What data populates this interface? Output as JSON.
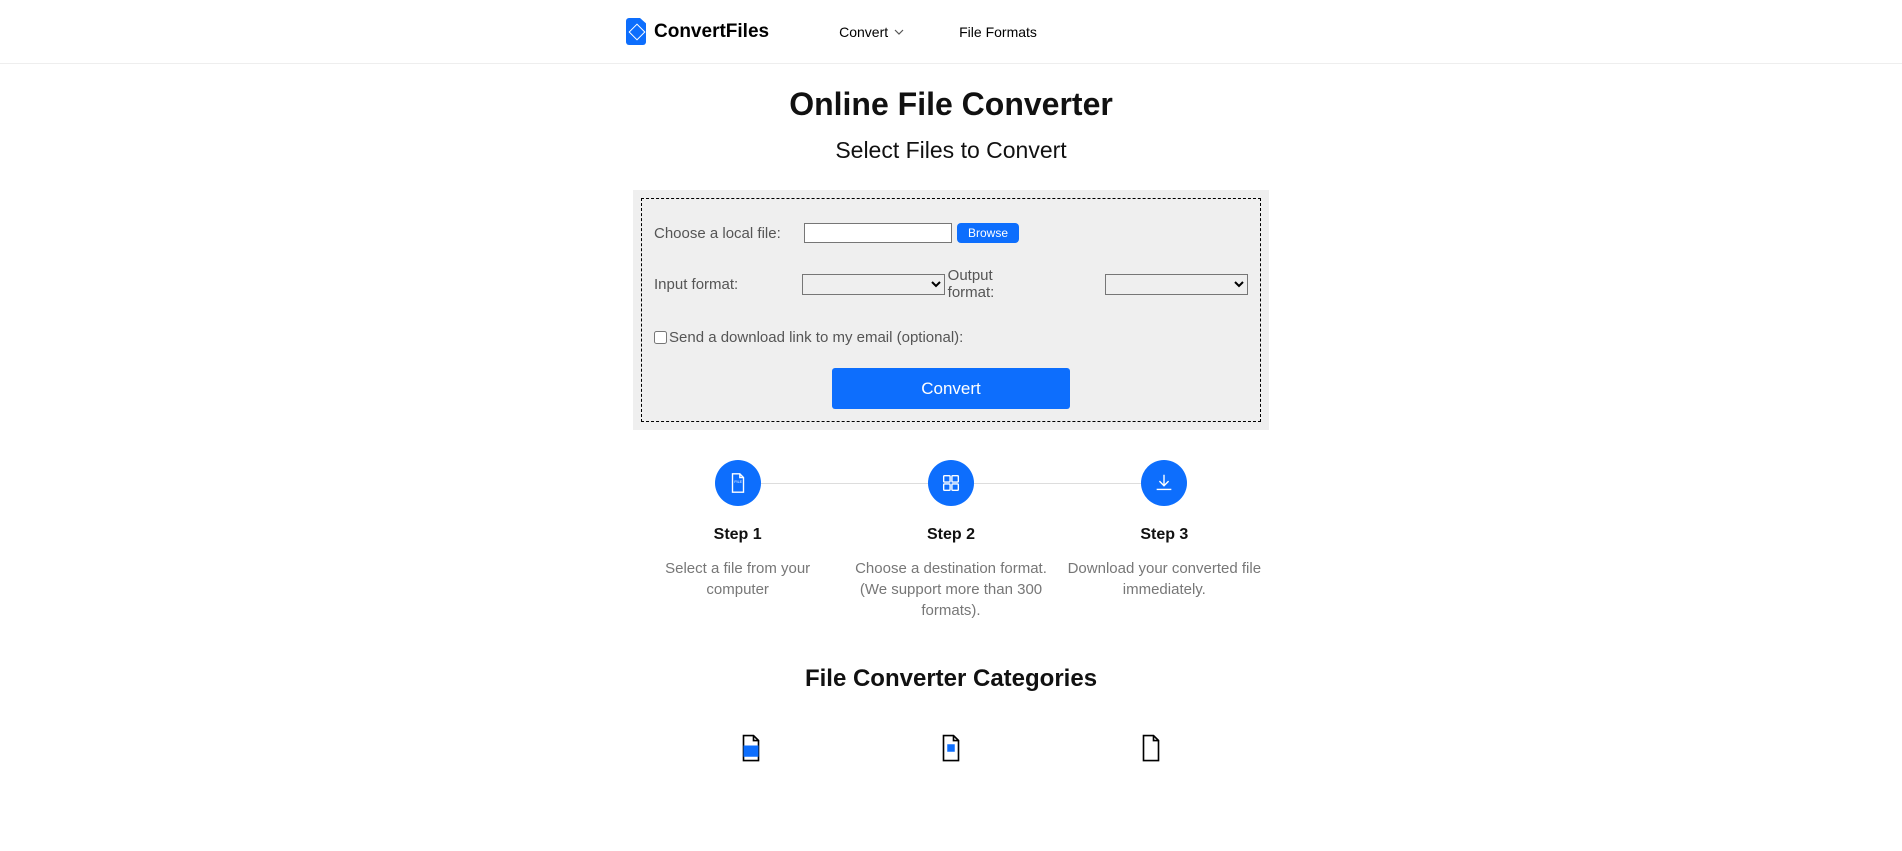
{
  "brand": {
    "name": "ConvertFiles"
  },
  "nav": {
    "convert_label": "Convert",
    "file_formats_label": "File Formats"
  },
  "hero": {
    "title": "Online File Converter",
    "subtitle": "Select Files to Convert"
  },
  "form": {
    "choose_file_label": "Choose a local file:",
    "browse_label": "Browse",
    "input_format_label": "Input format:",
    "output_format_label": "Output format:",
    "email_label": "Send a download link to my email (optional):",
    "convert_label": "Convert"
  },
  "steps": [
    {
      "title": "Step 1",
      "desc": "Select a file from your computer"
    },
    {
      "title": "Step 2",
      "desc": "Choose a destination format. (We support more than 300 formats)."
    },
    {
      "title": "Step 3",
      "desc": "Download your converted file immediately."
    }
  ],
  "categories": {
    "title": "File Converter Categories"
  }
}
